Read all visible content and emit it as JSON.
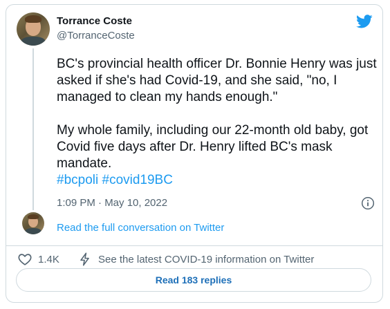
{
  "tweet": {
    "author_name": "Torrance Coste",
    "author_handle": "@TorranceCoste",
    "paragraph_1": "BC's provincial health officer Dr. Bonnie Henry was just asked if she's had Covid-19, and she said, \"no, I managed to clean my hands enough.\"",
    "paragraph_2": "My whole family, including our 22-month old baby, got Covid five days after Dr. Henry lifted BC's mask mandate.",
    "hashtags": [
      "#bcpoli",
      "#covid19BC"
    ],
    "timestamp": "1:09 PM · May 10, 2022"
  },
  "thread": {
    "read_conversation_label": "Read the full conversation on Twitter"
  },
  "actions": {
    "like_count": "1.4K",
    "covid_info_label": "See the latest COVID-19 information on Twitter",
    "replies_label": "Read 183 replies"
  },
  "colors": {
    "accent": "#1d9bf0",
    "text": "#0f1419",
    "muted": "#536471",
    "border": "#cfd9de"
  },
  "icons": [
    "twitter-bird-icon",
    "info-icon",
    "heart-icon",
    "bolt-icon"
  ]
}
